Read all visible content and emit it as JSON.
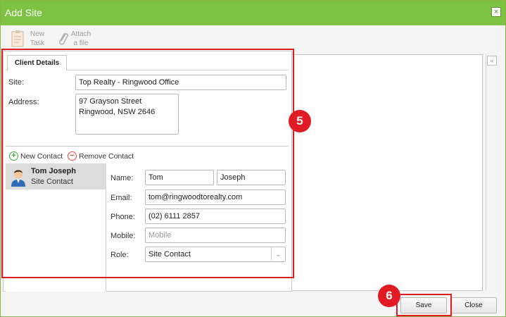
{
  "window": {
    "title": "Add Site",
    "close_glyph": "×"
  },
  "toolbar": {
    "new_task": "New\nTask",
    "attach_file": "Attach\na file"
  },
  "tabs": {
    "client_details": "Client Details"
  },
  "site": {
    "label": "Site:",
    "value": "Top Realty - Ringwood Office"
  },
  "address": {
    "label": "Address:",
    "value": "97 Grayson Street\nRingwood, NSW 2646"
  },
  "contacts": {
    "new_contact": "New Contact",
    "remove_contact": "Remove Contact",
    "list": [
      {
        "name": "Tom Joseph",
        "role": "Site Contact"
      }
    ]
  },
  "contact_form": {
    "name_label": "Name:",
    "first_name": "Tom",
    "last_name": "Joseph",
    "email_label": "Email:",
    "email": "tom@ringwoodtorealty.com",
    "phone_label": "Phone:",
    "phone": "(02) 6111 2857",
    "mobile_label": "Mobile:",
    "mobile_placeholder": "Mobile",
    "role_label": "Role:",
    "role_value": "Site Contact"
  },
  "annotations": {
    "step_5": "5",
    "step_6": "6"
  },
  "buttons": {
    "save": "Save",
    "close": "Close"
  },
  "colors": {
    "titlebar": "#7dc242",
    "annotation": "#e01b24",
    "add_icon": "#3aa83a",
    "remove_icon": "#e0443a"
  }
}
